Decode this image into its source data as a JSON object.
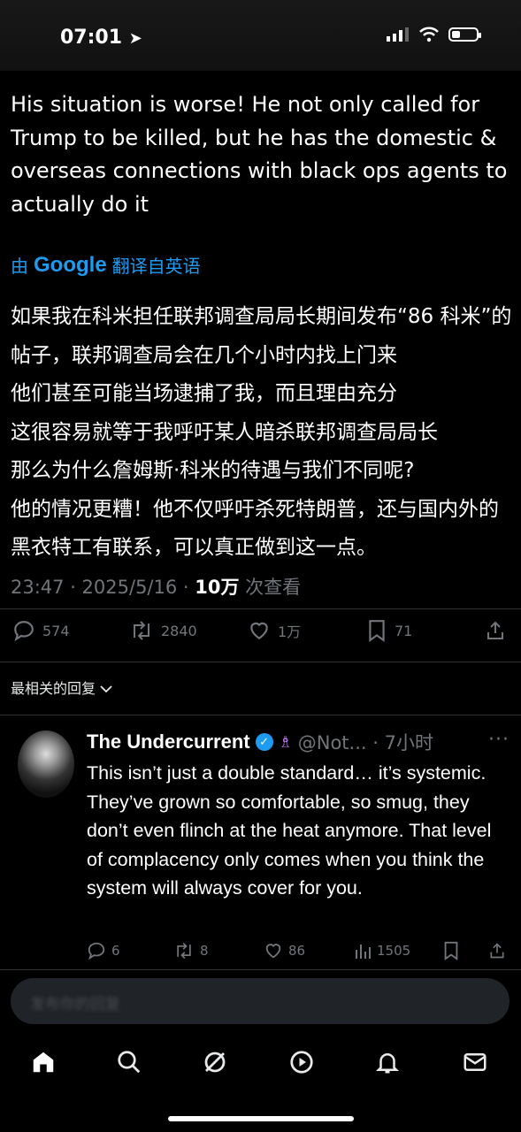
{
  "status_bar": {
    "time": "07:01"
  },
  "tweet": {
    "text_en": "His situation is worse! He not only called for Trump to be killed, but he has the domestic & overseas connections with black ops agents to actually do it",
    "translated_by": "由",
    "translator_brand": "Google",
    "translated_from": "翻译自英语",
    "text_zh": [
      "如果我在科米担任联邦调查局局长期间发布“86 科米”的帖子，联邦调查局会在几个小时内找上门来",
      "他们甚至可能当场逮捕了我，而且理由充分",
      "这很容易就等于我呼吁某人暗杀联邦调查局局长",
      "那么为什么詹姆斯·科米的待遇与我们不同呢?",
      "他的情况更糟！他不仅呼吁杀死特朗普，还与国内外的黑衣特工有联系，可以真正做到这一点。"
    ],
    "time_date": "23:47 · 2025/5/16 · ",
    "views_count": "10万",
    "views_label": " 次查看",
    "replies": "574",
    "retweets": "2840",
    "likes": "1万",
    "bookmarks": "71"
  },
  "sort_label": "最相关的回复",
  "reply": {
    "name": "The Undercurrent",
    "handle_time": "@Not... · 7小时",
    "text": "This isn’t just a double standard… it’s systemic. They’ve grown so comfortable, so smug, they don’t even flinch at the heat anymore. That level of complacency only comes when you think the system will always cover for you.",
    "replies": "6",
    "retweets": "8",
    "likes": "86",
    "views": "1505"
  },
  "compose": {
    "placeholder": "发布你的回复"
  },
  "tabs": [
    "home-icon",
    "search-icon",
    "grok-icon",
    "video-icon",
    "notifications-icon",
    "messages-icon"
  ],
  "colors": {
    "accent": "#1d9bf0",
    "muted": "#71767b",
    "background": "#000000"
  }
}
